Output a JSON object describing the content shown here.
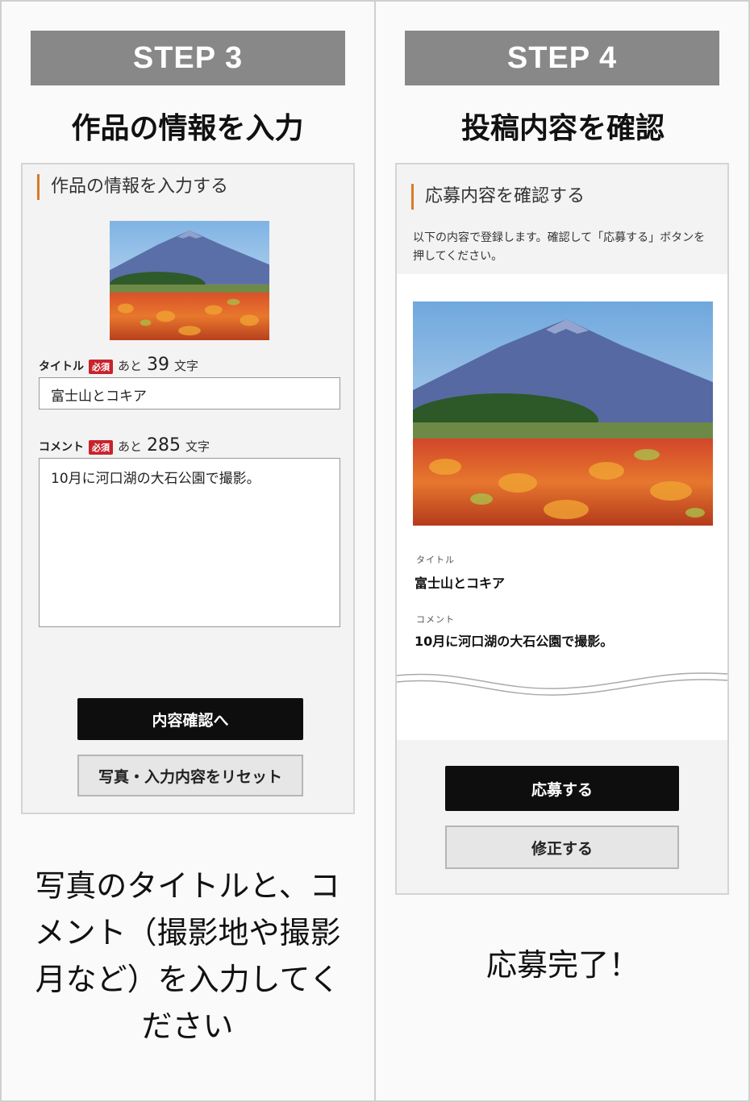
{
  "left": {
    "step_label": "STEP 3",
    "heading": "作品の情報を入力",
    "section_title": "作品の情報を入力する",
    "title_field": {
      "label": "タイトル",
      "required": "必須",
      "remaining_prefix": "あと",
      "remaining_count": "39",
      "remaining_suffix": "文字",
      "value": "富士山とコキア"
    },
    "comment_field": {
      "label": "コメント",
      "required": "必須",
      "remaining_prefix": "あと",
      "remaining_count": "285",
      "remaining_suffix": "文字",
      "value": "10月に河口湖の大石公園で撮影。"
    },
    "confirm_button": "内容確認へ",
    "reset_button": "写真・入力内容をリセット",
    "caption_lines": [
      "写真のタイトルと、コ",
      "メント（撮影地や撮影",
      "月など）を入力してく",
      "ださい"
    ]
  },
  "right": {
    "step_label": "STEP 4",
    "heading": "投稿内容を確認",
    "section_title": "応募内容を確認する",
    "note": "以下の内容で登録します。確認して「応募する」ボタンを押してください。",
    "title_label": "タイトル",
    "title_value": "富士山とコキア",
    "comment_label": "コメント",
    "comment_value": "10月に河口湖の大石公園で撮影。",
    "submit_button": "応募する",
    "edit_button": "修正する",
    "caption": "応募完了！"
  },
  "colors": {
    "banner": "#888888",
    "accent_bar": "#d97a2a",
    "required_badge": "#c8232c",
    "primary_button": "#0e0e0e"
  }
}
